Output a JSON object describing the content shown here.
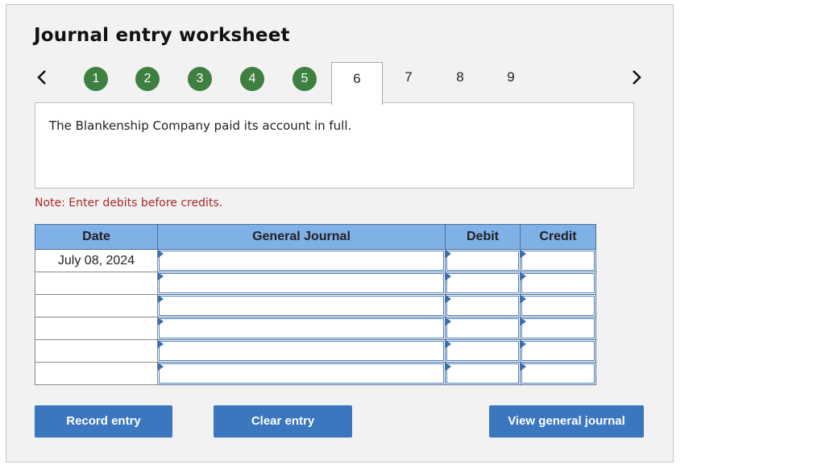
{
  "title": "Journal entry worksheet",
  "nav": {
    "prev_icon": "chevron-left-icon",
    "next_icon": "chevron-right-icon",
    "completed_steps": [
      "1",
      "2",
      "3",
      "4",
      "5"
    ],
    "active_step": "6",
    "upcoming_steps": [
      "7",
      "8",
      "9"
    ],
    "completed_color": "#3f7f3f"
  },
  "description": "The Blankenship Company paid its account in full.",
  "note": "Note: Enter debits before credits.",
  "journal": {
    "headers": {
      "date": "Date",
      "general_journal": "General Journal",
      "debit": "Debit",
      "credit": "Credit"
    },
    "header_color": "#7fb0e6",
    "rows": [
      {
        "date": "July 08, 2024",
        "account": "",
        "debit": "",
        "credit": ""
      },
      {
        "date": "",
        "account": "",
        "debit": "",
        "credit": ""
      },
      {
        "date": "",
        "account": "",
        "debit": "",
        "credit": ""
      },
      {
        "date": "",
        "account": "",
        "debit": "",
        "credit": ""
      },
      {
        "date": "",
        "account": "",
        "debit": "",
        "credit": ""
      },
      {
        "date": "",
        "account": "",
        "debit": "",
        "credit": ""
      }
    ]
  },
  "buttons": {
    "record": "Record entry",
    "clear": "Clear entry",
    "view": "View general journal",
    "color": "#3a77bf"
  }
}
